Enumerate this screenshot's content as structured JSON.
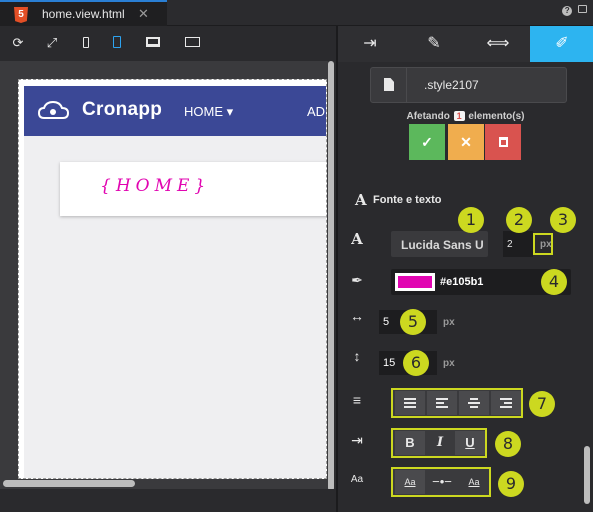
{
  "tab": {
    "title": "home.view.html",
    "close": "✕",
    "badge": "5"
  },
  "strip": {
    "help": "?"
  },
  "devices": [
    "refresh-icon",
    "expand-icon",
    "mobile-icon",
    "tablet-icon",
    "desktop-icon",
    "monitor-icon"
  ],
  "preview": {
    "brand": "Cronapp",
    "nav_home": "HOME ▾",
    "nav_next": "AD",
    "home_text": "{HOME}"
  },
  "panel": {
    "tabs": [
      "enter-icon",
      "pencil-icon",
      "resize-icon",
      "wand-icon"
    ],
    "selector": ".style2107",
    "affect_pre": "Afetando",
    "affect_count": "1",
    "affect_post": "elemento(s)",
    "confirm": "✓",
    "cancel": "✕",
    "delete": "🗑",
    "section_title": "Fonte e texto",
    "font_family": "Lucida Sans U",
    "font_size": "2",
    "unit_px": "px",
    "color_hex": "#e105b1",
    "letter_spacing": "5",
    "line_height": "15",
    "style_bold": "B",
    "style_italic": "I",
    "style_underline": "U"
  },
  "colors": {
    "accent": "#2db4f0",
    "brand": "#3b4896",
    "text_color": "#e105b1",
    "callout": "#ccd820",
    "confirm": "#5cb85c",
    "cancel": "#f0ad4e",
    "delete": "#d9534f"
  },
  "callouts": [
    "1",
    "2",
    "3",
    "4",
    "5",
    "6",
    "7",
    "8",
    "9"
  ]
}
